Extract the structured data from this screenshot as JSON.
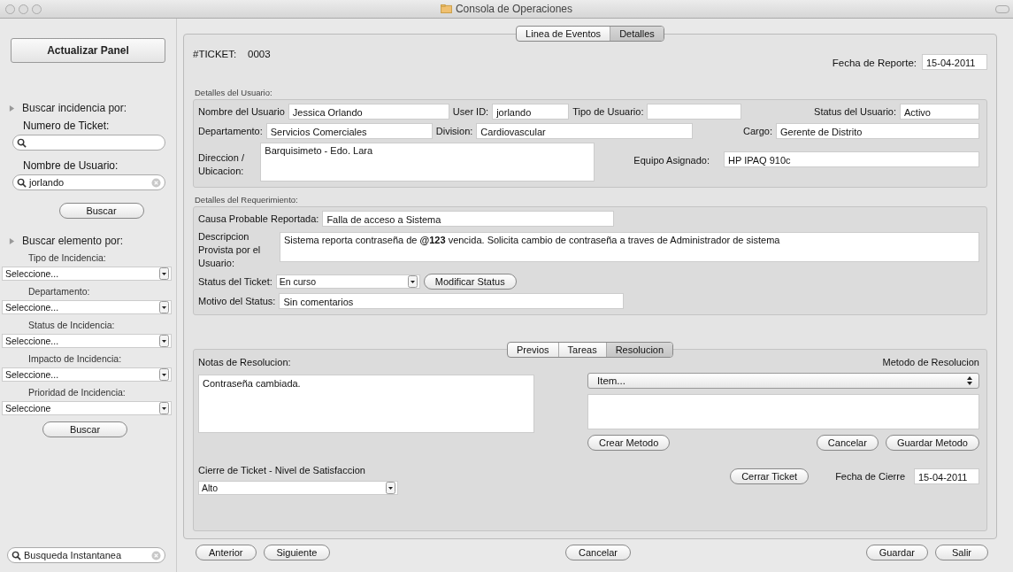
{
  "window": {
    "title": "Consola de Operaciones"
  },
  "sidebar": {
    "refresh_button": "Actualizar Panel",
    "incident_search": {
      "heading": "Buscar incidencia por:",
      "ticket_label": "Numero de Ticket:",
      "user_label": "Nombre de Usuario:",
      "user_value": "jorlando",
      "button": "Buscar"
    },
    "element_search": {
      "heading": "Buscar elemento por:",
      "filters": [
        {
          "label": "Tipo de Incidencia:",
          "value": "Seleccione..."
        },
        {
          "label": "Departamento:",
          "value": "Seleccione..."
        },
        {
          "label": "Status de Incidencia:",
          "value": "Seleccione..."
        },
        {
          "label": "Impacto de Incidencia:",
          "value": "Seleccione..."
        },
        {
          "label": "Prioridad de Incidencia:",
          "value": "Seleccione"
        }
      ],
      "button": "Buscar"
    },
    "instant_search": {
      "placeholder": "Busqueda Instantanea"
    }
  },
  "tabs": [
    {
      "label": "Linea de Eventos",
      "selected": false
    },
    {
      "label": "Detalles",
      "selected": true
    }
  ],
  "ticket": {
    "label": "#TICKET:",
    "number": "0003",
    "report_date_label": "Fecha de Reporte:",
    "report_date": "15-04-2011"
  },
  "user_details": {
    "title": "Detalles del Usuario:",
    "name": {
      "label": "Nombre del Usuario",
      "value": "Jessica Orlando"
    },
    "user_id": {
      "label": "User ID:",
      "value": "jorlando"
    },
    "user_type": {
      "label": "Tipo de Usuario:"
    },
    "status": {
      "label": "Status del Usuario:",
      "value": "Activo"
    },
    "department": {
      "label": "Departamento:",
      "value": "Servicios Comerciales"
    },
    "division": {
      "label": "Division:",
      "value": "Cardiovascular"
    },
    "position": {
      "label": "Cargo:",
      "value": "Gerente de Distrito"
    },
    "address": {
      "label": "Direccion / Ubicacion:",
      "value": "Barquisimeto - Edo. Lara"
    },
    "equipment": {
      "label": "Equipo Asignado:",
      "value": "HP IPAQ 910c"
    }
  },
  "requirement": {
    "title": "Detalles del Requerimiento:",
    "cause": {
      "label": "Causa Probable Reportada:",
      "value": "Falla de acceso a Sistema"
    },
    "description": {
      "label": "Descripcion Provista por el Usuario:",
      "value": "Sistema reporta contraseña de **@123** vencida. Solicita cambio de contraseña a traves de Administrador de sistema"
    },
    "ticket_status": {
      "label": "Status del Ticket:",
      "value": "En curso"
    },
    "modify_button": "Modificar Status",
    "status_reason": {
      "label": "Motivo del Status:",
      "value": "Sin comentarios"
    }
  },
  "subtabs": [
    {
      "label": "Previos",
      "selected": false
    },
    {
      "label": "Tareas",
      "selected": false
    },
    {
      "label": "Resolucion",
      "selected": true
    }
  ],
  "resolution": {
    "notes_label": "Notas de Resolucion:",
    "notes": "Contraseña cambiada.",
    "method_label": "Metodo de Resolucion",
    "method_value": "Item...",
    "create_button": "Crear Metodo",
    "cancel_button": "Cancelar",
    "save_button": "Guardar Metodo",
    "closure_label": "Cierre de Ticket - Nivel de Satisfaccion",
    "satisfaction": "Alto",
    "close_button": "Cerrar Ticket",
    "close_date_label": "Fecha de Cierre",
    "close_date": "15-04-2011"
  },
  "footer": {
    "left": [
      "Anterior",
      "Siguiente"
    ],
    "center": [
      "Cancelar"
    ],
    "right": [
      "Guardar",
      "Salir"
    ]
  }
}
